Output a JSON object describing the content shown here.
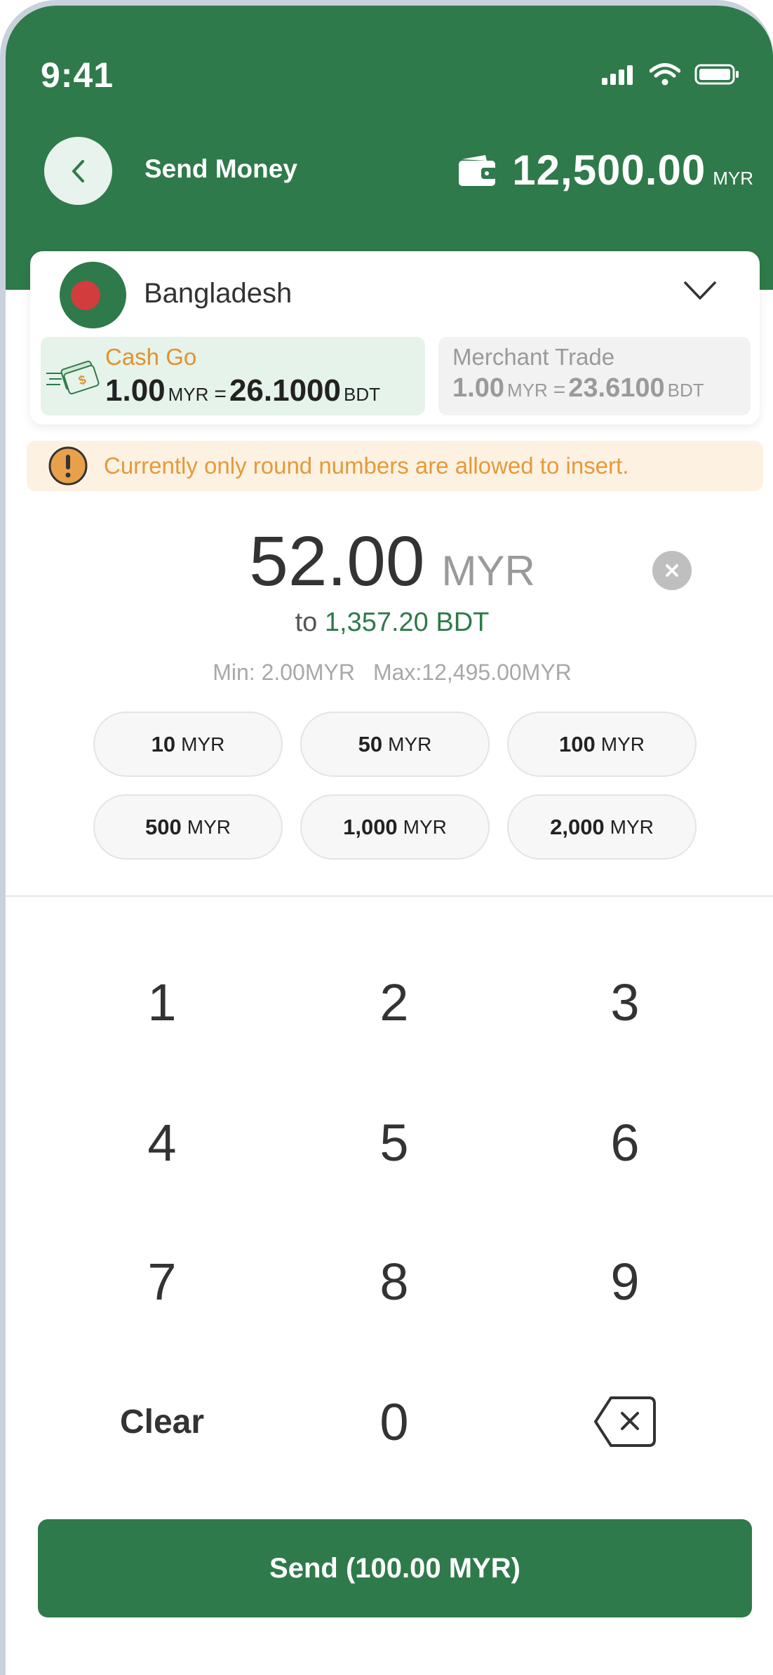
{
  "status_bar": {
    "time": "9:41"
  },
  "header": {
    "title": "Send Money",
    "balance_amount": "12,500.00",
    "balance_currency": "MYR"
  },
  "country": {
    "name": "Bangladesh"
  },
  "rates": [
    {
      "label": "Cash Go",
      "from_amount": "1.00",
      "from_currency": "MYR",
      "equals": "=",
      "to_amount": "26.1000",
      "to_currency": "BDT",
      "selected": true
    },
    {
      "label": "Merchant Trade",
      "from_amount": "1.00",
      "from_currency": "MYR",
      "equals": "=",
      "to_amount": "23.6100",
      "to_currency": "BDT",
      "selected": false
    }
  ],
  "warning": {
    "text": "Currently only round numbers are allowed to insert."
  },
  "amount": {
    "value": "52.00",
    "currency": "MYR",
    "converted_prefix": "to",
    "converted_value": "1,357.20 BDT",
    "min": "Min: 2.00MYR",
    "max": "Max:12,495.00MYR"
  },
  "quick_amounts": [
    {
      "value": "10",
      "currency": "MYR"
    },
    {
      "value": "50",
      "currency": "MYR"
    },
    {
      "value": "100",
      "currency": "MYR"
    },
    {
      "value": "500",
      "currency": "MYR"
    },
    {
      "value": "1,000",
      "currency": "MYR"
    },
    {
      "value": "2,000",
      "currency": "MYR"
    }
  ],
  "keypad": {
    "k1": "1",
    "k2": "2",
    "k3": "3",
    "k4": "4",
    "k5": "5",
    "k6": "6",
    "k7": "7",
    "k8": "8",
    "k9": "9",
    "clear": "Clear",
    "k0": "0"
  },
  "send_button": {
    "label": "Send (100.00 MYR)"
  },
  "colors": {
    "primary": "#2e7a4a",
    "warning": "#e49a3a",
    "flag_red": "#d23c3c"
  }
}
